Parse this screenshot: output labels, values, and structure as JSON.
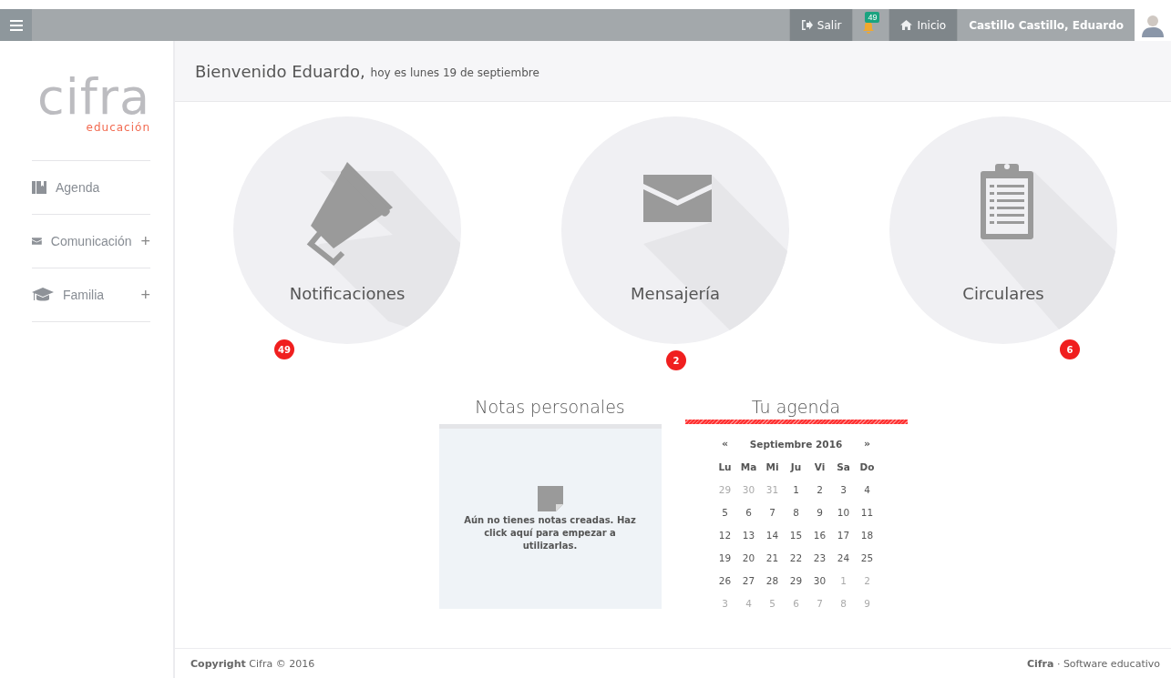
{
  "topbar": {
    "logout": "Salir",
    "notification_count": "49",
    "home": "Inicio",
    "user": "Castillo Castillo, Eduardo"
  },
  "sidebar": {
    "logo": {
      "name": "cifra",
      "tagline": "educación"
    },
    "items": [
      {
        "kind": "book",
        "label": "Agenda"
      },
      {
        "kind": "envelope",
        "label": "Comunicación",
        "expander": "+"
      },
      {
        "kind": "cap",
        "label": "Familia",
        "expander": "+"
      }
    ]
  },
  "welcome": {
    "greeting": "Bienvenido Eduardo,",
    "date": "hoy es lunes 19 de septiembre"
  },
  "tiles": [
    {
      "kind": "megaphone",
      "label": "Notificaciones",
      "badge": "49"
    },
    {
      "kind": "envelope",
      "label": "Mensajería",
      "badge": "2"
    },
    {
      "kind": "clipboard",
      "label": "Circulares",
      "badge": "6"
    }
  ],
  "notes": {
    "title": "Notas personales",
    "message": "Aún no tienes notas creadas. Haz click aquí para empezar a utilizarlas."
  },
  "agenda": {
    "title": "Tu agenda",
    "prev": "«",
    "month": "Septiembre 2016",
    "next": "»",
    "weekdays": [
      "Lu",
      "Ma",
      "Mi",
      "Ju",
      "Vi",
      "Sa",
      "Do"
    ],
    "weeks": [
      [
        {
          "day": "29",
          "muted": true
        },
        {
          "day": "30",
          "muted": true
        },
        {
          "day": "31",
          "muted": true
        },
        {
          "day": "1",
          "muted": false
        },
        {
          "day": "2",
          "muted": false
        },
        {
          "day": "3",
          "muted": false
        },
        {
          "day": "4",
          "muted": false
        }
      ],
      [
        {
          "day": "5",
          "muted": false
        },
        {
          "day": "6",
          "muted": false
        },
        {
          "day": "7",
          "muted": false
        },
        {
          "day": "8",
          "muted": false
        },
        {
          "day": "9",
          "muted": false
        },
        {
          "day": "10",
          "muted": false
        },
        {
          "day": "11",
          "muted": false
        }
      ],
      [
        {
          "day": "12",
          "muted": false
        },
        {
          "day": "13",
          "muted": false
        },
        {
          "day": "14",
          "muted": false
        },
        {
          "day": "15",
          "muted": false
        },
        {
          "day": "16",
          "muted": false
        },
        {
          "day": "17",
          "muted": false
        },
        {
          "day": "18",
          "muted": false
        }
      ],
      [
        {
          "day": "19",
          "muted": false
        },
        {
          "day": "20",
          "muted": false
        },
        {
          "day": "21",
          "muted": false
        },
        {
          "day": "22",
          "muted": false
        },
        {
          "day": "23",
          "muted": false
        },
        {
          "day": "24",
          "muted": false
        },
        {
          "day": "25",
          "muted": false
        }
      ],
      [
        {
          "day": "26",
          "muted": false
        },
        {
          "day": "27",
          "muted": false
        },
        {
          "day": "28",
          "muted": false
        },
        {
          "day": "29",
          "muted": false
        },
        {
          "day": "30",
          "muted": false
        },
        {
          "day": "1",
          "muted": true
        },
        {
          "day": "2",
          "muted": true
        }
      ],
      [
        {
          "day": "3",
          "muted": true
        },
        {
          "day": "4",
          "muted": true
        },
        {
          "day": "5",
          "muted": true
        },
        {
          "day": "6",
          "muted": true
        },
        {
          "day": "7",
          "muted": true
        },
        {
          "day": "8",
          "muted": true
        },
        {
          "day": "9",
          "muted": true
        }
      ]
    ]
  },
  "footer": {
    "left": "**Copyright** Cifra © 2016",
    "right": "**Cifra** · Software educativo"
  }
}
